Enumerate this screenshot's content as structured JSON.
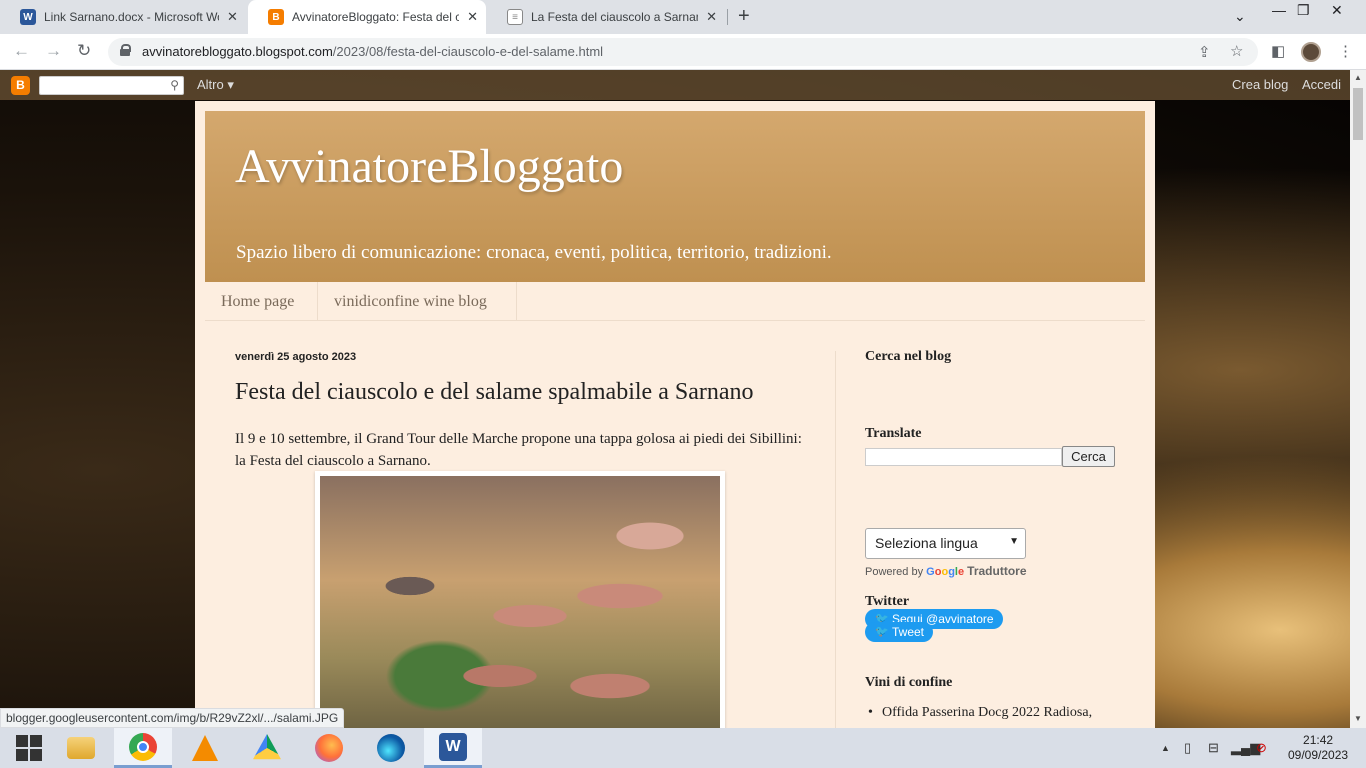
{
  "browser": {
    "tabs": [
      {
        "title": "Link Sarnano.docx - Microsoft Wo",
        "favicon": "word-icon",
        "favicon_color": "#2b579a"
      },
      {
        "title": "AvvinatoreBloggato: Festa del cia",
        "favicon": "blogger-icon",
        "favicon_color": "#f57d00"
      },
      {
        "title": "La Festa del ciauscolo a Sarnano",
        "favicon": "page-icon",
        "favicon_color": "#888888"
      }
    ],
    "url_domain": "avvinatorebloggato.blogspot.com",
    "url_path": "/2023/08/festa-del-ciauscolo-e-del-salame.html"
  },
  "blogger_nav": {
    "more": "Altro",
    "create_blog": "Crea blog",
    "sign_in": "Accedi"
  },
  "blog": {
    "title": "AvvinatoreBloggato",
    "description": "Spazio libero di comunicazione: cronaca, eventi, politica, territorio, tradizioni.",
    "tabs": [
      "Home page",
      "vinidiconfine wine blog"
    ]
  },
  "post": {
    "date": "venerdì 25 agosto 2023",
    "title": "Festa del ciauscolo e del salame spalmabile a Sarnano",
    "body": "Il 9 e 10 settembre, il Grand Tour delle Marche propone una tappa golosa ai piedi dei Sibillini: la Festa del ciauscolo a Sarnano."
  },
  "sidebar": {
    "search_heading": "Cerca nel blog",
    "search_button": "Cerca",
    "translate_heading": "Translate",
    "language_select": "Seleziona lingua",
    "powered_by": "Powered by",
    "google": "Google",
    "translator": "Traduttore",
    "follow_button": "Segui @avvinatore",
    "twitter_heading": "Twitter",
    "tweet_button": "Tweet",
    "vini_heading": "Vini di confine",
    "vini_items": [
      "Offida Passerina Docg 2022 Radiosa,"
    ]
  },
  "status_url": "blogger.googleusercontent.com/img/b/R29vZ2xl/.../salami.JPG",
  "taskbar": {
    "apps": [
      "file-explorer-icon",
      "chrome-icon",
      "vlc-icon",
      "google-drive-icon",
      "firefox-icon",
      "edge-icon",
      "word-icon"
    ],
    "time": "21:42",
    "date": "09/09/2023"
  }
}
